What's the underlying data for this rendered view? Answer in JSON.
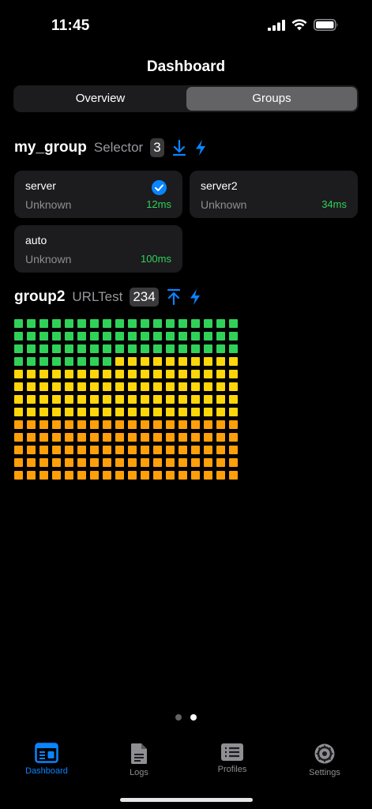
{
  "status_bar": {
    "time": "11:45"
  },
  "header": {
    "title": "Dashboard"
  },
  "segmented": {
    "items": [
      "Overview",
      "Groups"
    ],
    "selected": "Groups"
  },
  "groups": [
    {
      "name": "my_group",
      "type": "Selector",
      "count": "3",
      "proxies": [
        {
          "name": "server",
          "status": "Unknown",
          "delay": "12ms",
          "selected": true
        },
        {
          "name": "server2",
          "status": "Unknown",
          "delay": "34ms",
          "selected": false
        },
        {
          "name": "auto",
          "status": "Unknown",
          "delay": "100ms",
          "selected": false
        }
      ]
    },
    {
      "name": "group2",
      "type": "URLTest",
      "count": "234",
      "latency_grid": {
        "total": 234,
        "columns": 18,
        "green": 62,
        "yellow": 82,
        "orange": 90,
        "colors": {
          "green": "#30d158",
          "yellow": "#ffd60a",
          "orange": "#ff9f0a"
        }
      }
    }
  ],
  "page_indicator": {
    "pages": 2,
    "current": 2
  },
  "tab_bar": {
    "items": [
      {
        "label": "Dashboard",
        "icon": "dashboard-icon",
        "active": true
      },
      {
        "label": "Logs",
        "icon": "document-icon",
        "active": false
      },
      {
        "label": "Profiles",
        "icon": "list-icon",
        "active": false
      },
      {
        "label": "Settings",
        "icon": "gear-icon",
        "active": false
      }
    ]
  },
  "colors": {
    "accent": "#0a84ff",
    "delay_good": "#30d158",
    "inactive_tab": "#8e8e93"
  }
}
